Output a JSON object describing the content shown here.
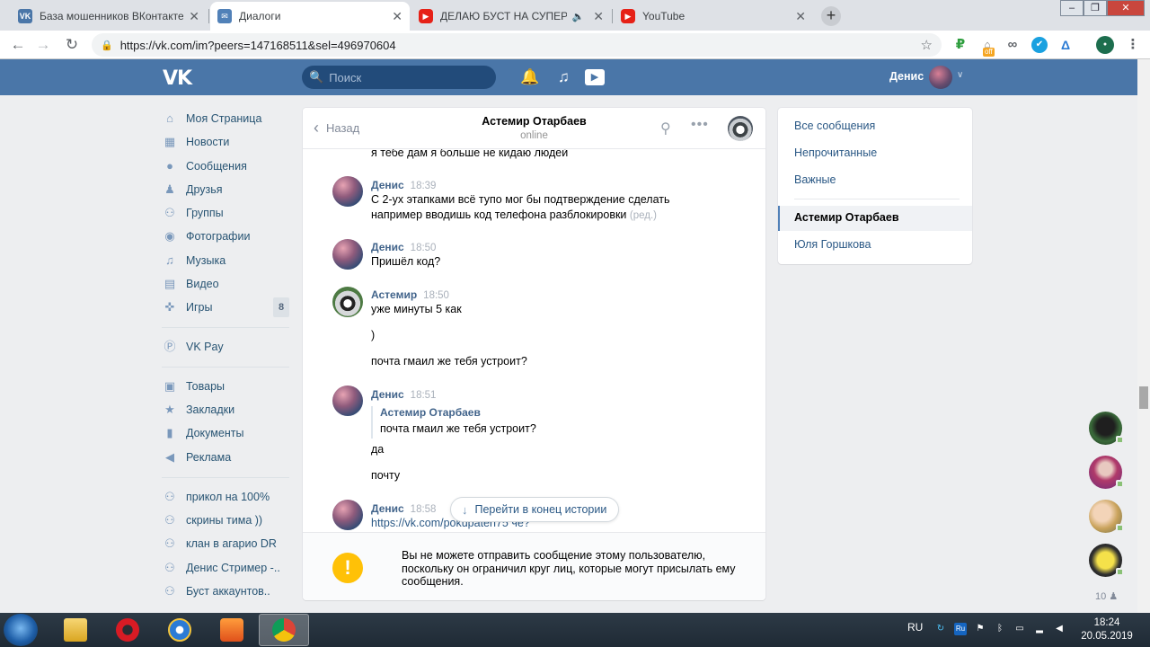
{
  "browser": {
    "tabs": [
      {
        "title": "База мошенников ВКонтакте К",
        "favicon": "vk-icon",
        "active": false
      },
      {
        "title": "Диалоги",
        "favicon": "vk-messages-icon",
        "active": true
      },
      {
        "title": "ДЕЛАЮ БУСТ НА СУПЕР АК",
        "favicon": "youtube-icon",
        "active": false
      },
      {
        "title": "YouTube",
        "favicon": "youtube-icon",
        "active": false
      }
    ],
    "url": "https://vk.com/im?peers=147168511&sel=496970604",
    "ext_off_label": "off",
    "colors": {
      "tab_bar": "#dee1e6",
      "vk_blue": "#4a76a8"
    }
  },
  "vk_header": {
    "logo": "VK",
    "search_placeholder": "Поиск",
    "user_name": "Денис"
  },
  "left_nav": {
    "items": [
      {
        "label": "Моя Страница",
        "icon": "home-icon"
      },
      {
        "label": "Новости",
        "icon": "news-icon"
      },
      {
        "label": "Сообщения",
        "icon": "messages-icon"
      },
      {
        "label": "Друзья",
        "icon": "friends-icon"
      },
      {
        "label": "Группы",
        "icon": "groups-icon"
      },
      {
        "label": "Фотографии",
        "icon": "camera-icon"
      },
      {
        "label": "Музыка",
        "icon": "music-icon"
      },
      {
        "label": "Видео",
        "icon": "video-icon"
      },
      {
        "label": "Игры",
        "icon": "games-icon",
        "count": "8"
      }
    ],
    "pay": {
      "label": "VK Pay",
      "icon": "vkpay-icon"
    },
    "items2": [
      {
        "label": "Товары",
        "icon": "shopping-bag-icon"
      },
      {
        "label": "Закладки",
        "icon": "star-icon"
      },
      {
        "label": "Документы",
        "icon": "document-icon"
      },
      {
        "label": "Реклама",
        "icon": "megaphone-icon"
      }
    ],
    "groups": [
      {
        "label": "прикол на 100%"
      },
      {
        "label": "скрины тима ))"
      },
      {
        "label": "клан в агарио DR"
      },
      {
        "label": "Денис Стример -.."
      },
      {
        "label": "Буст аккаунтов.."
      }
    ]
  },
  "chat": {
    "back_label": "Назад",
    "peer_name": "Астемир Отарбаев",
    "peer_status": "online",
    "partial_line": "я тебе дам я больше не кидаю людей",
    "messages": [
      {
        "author": "Денис",
        "time": "18:39",
        "lines": [
          "С 2-ух этапками всё тупо мог бы подтверждение сделать",
          "например вводишь код телефона разблокировки"
        ],
        "edited": "(ред.)"
      },
      {
        "author": "Денис",
        "time": "18:50",
        "lines": [
          "Пришёл код?"
        ]
      },
      {
        "author": "Астемир",
        "time": "18:50",
        "lines": [
          "уже минуты 5 как",
          ")",
          "почта гмаил же тебя устроит?"
        ]
      },
      {
        "author": "Денис",
        "time": "18:51",
        "quote": {
          "author": "Астемир Отарбаев",
          "text": "почта гмаил же тебя устроит?"
        },
        "lines": [
          "да",
          "почту"
        ]
      },
      {
        "author": "Денис",
        "time": "18:58",
        "lines": [
          "https://vk.com/pokupaten75 че?"
        ]
      }
    ],
    "goto_end": "Перейти в конец истории",
    "warning_icon": "exclamation-icon",
    "warning": "Вы не можете отправить сообщение этому пользователю, поскольку он ограничил круг лиц, которые могут присылать ему сообщения."
  },
  "folders": {
    "items": [
      "Все сообщения",
      "Непрочитанные",
      "Важные"
    ],
    "conversations": [
      "Астемир Отарбаев",
      "Юля Горшкова"
    ]
  },
  "friends_rail": {
    "avatars": 4,
    "count": "10"
  },
  "taskbar": {
    "lang": "RU",
    "time": "18:24",
    "date": "20.05.2019",
    "apps": [
      "explorer-icon",
      "opera-icon",
      "ie-icon",
      "media-player-icon",
      "chrome-icon"
    ]
  }
}
